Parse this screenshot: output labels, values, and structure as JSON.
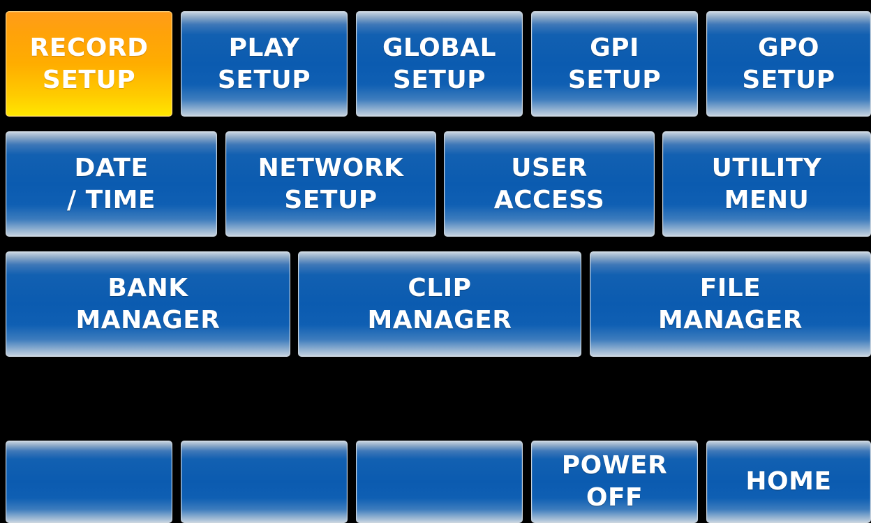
{
  "menu": {
    "row1": {
      "record_setup": {
        "line1": "RECORD",
        "line2": "SETUP",
        "active": true
      },
      "play_setup": {
        "line1": "PLAY",
        "line2": "SETUP"
      },
      "global_setup": {
        "line1": "GLOBAL",
        "line2": "SETUP"
      },
      "gpi_setup": {
        "line1": "GPI",
        "line2": "SETUP"
      },
      "gpo_setup": {
        "line1": "GPO",
        "line2": "SETUP"
      }
    },
    "row2": {
      "date_time": {
        "line1": "DATE",
        "line2": "/ TIME"
      },
      "network_setup": {
        "line1": "NETWORK",
        "line2": "SETUP"
      },
      "user_access": {
        "line1": "USER",
        "line2": "ACCESS"
      },
      "utility_menu": {
        "line1": "UTILITY",
        "line2": "MENU"
      }
    },
    "row3": {
      "bank_manager": {
        "line1": "BANK",
        "line2": "MANAGER"
      },
      "clip_manager": {
        "line1": "CLIP",
        "line2": "MANAGER"
      },
      "file_manager": {
        "line1": "FILE",
        "line2": "MANAGER"
      }
    }
  },
  "bottom_bar": {
    "power_off": {
      "line1": "POWER",
      "line2": "OFF"
    },
    "home": {
      "label": "HOME"
    }
  },
  "colors": {
    "button_blue": "#0b5bb0",
    "active_orange": "#ffad00",
    "active_yellow": "#ffe600",
    "background": "#000000",
    "text": "#ffffff"
  }
}
